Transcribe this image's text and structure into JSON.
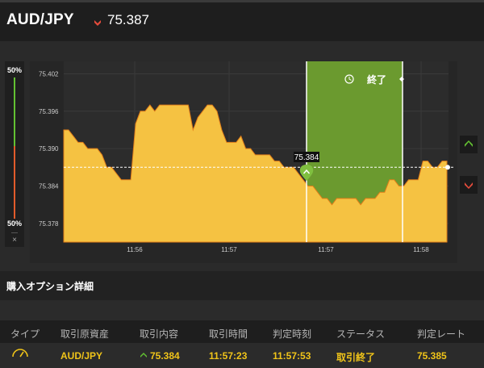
{
  "header": {
    "pair": "AUD/JPY",
    "rate": "75.387",
    "direction_icon": "down-arrow-icon",
    "direction_color": "#e74c3c"
  },
  "gauge": {
    "top_percent": "50%",
    "bottom_percent": "50%",
    "close_label": "×"
  },
  "chart": {
    "y_ticks": [
      "75.402",
      "75.396",
      "75.390",
      "75.384",
      "75.378"
    ],
    "x_ticks": [
      "11:56",
      "11:57",
      "11:57",
      "11:58"
    ],
    "current_price_label": "75.384",
    "countdown_label": "終了",
    "area_color": "#f5c242",
    "window_color": "#6b9a2f"
  },
  "chart_data": {
    "type": "area",
    "ylim": [
      75.375,
      75.404
    ],
    "y_ticks": [
      75.402,
      75.396,
      75.39,
      75.384,
      75.378
    ],
    "x_tick_labels": [
      "11:56",
      "11:57",
      "11:57",
      "11:58"
    ],
    "values": [
      75.393,
      75.393,
      75.392,
      75.391,
      75.391,
      75.39,
      75.39,
      75.39,
      75.389,
      75.387,
      75.387,
      75.386,
      75.385,
      75.385,
      75.385,
      75.394,
      75.396,
      75.396,
      75.397,
      75.396,
      75.397,
      75.397,
      75.397,
      75.397,
      75.397,
      75.397,
      75.397,
      75.393,
      75.395,
      75.396,
      75.397,
      75.397,
      75.396,
      75.393,
      75.391,
      75.391,
      75.391,
      75.392,
      75.39,
      75.39,
      75.389,
      75.389,
      75.389,
      75.389,
      75.388,
      75.388,
      75.387,
      75.387,
      75.387,
      75.386,
      75.385,
      75.384,
      75.384,
      75.383,
      75.382,
      75.382,
      75.381,
      75.382,
      75.382,
      75.382,
      75.382,
      75.382,
      75.381,
      75.382,
      75.382,
      75.382,
      75.383,
      75.383,
      75.385,
      75.385,
      75.384,
      75.384,
      75.385,
      75.385,
      75.385,
      75.388,
      75.388,
      75.387,
      75.387,
      75.388,
      75.388
    ],
    "grid": true,
    "purchase_rate": 75.384,
    "current_rate": 75.387
  },
  "details": {
    "title": "購入オプション詳細",
    "columns": [
      "タイプ",
      "取引原資産",
      "取引内容",
      "取引時間",
      "判定時刻",
      "ステータス",
      "判定レート"
    ],
    "row": {
      "type_icon": "speedometer-icon",
      "asset": "AUD/JPY",
      "content": "75.384",
      "trade_time": "11:57:23",
      "judge_time": "11:57:53",
      "status": "取引終了",
      "judge_rate": "75.385"
    }
  },
  "side_buttons": {
    "high_icon": "high-arrow-icon",
    "low_icon": "low-arrow-icon"
  }
}
